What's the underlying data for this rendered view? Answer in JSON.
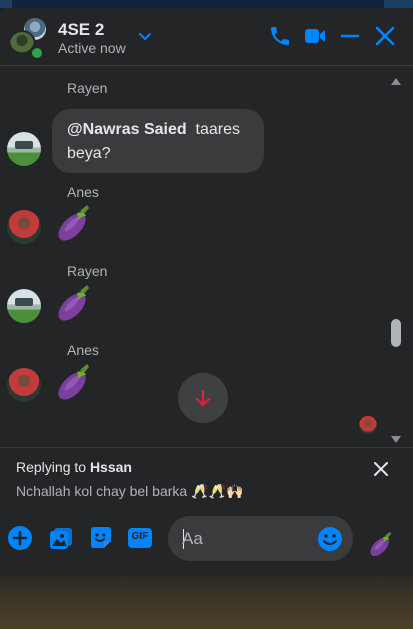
{
  "header": {
    "title": "4SE 2",
    "status": "Active now"
  },
  "messages": [
    {
      "sender": "Rayen",
      "mention": "@Nawras Saied",
      "text": "taares",
      "text2": "beya?",
      "type": "text"
    },
    {
      "sender": "Anes",
      "content": "eggplant-emoji",
      "type": "emoji"
    },
    {
      "sender": "Rayen",
      "content": "eggplant-emoji",
      "type": "emoji"
    },
    {
      "sender": "Anes",
      "content": "eggplant-emoji",
      "type": "emoji"
    }
  ],
  "reply": {
    "prefix": "Replying to",
    "name": "Hssan",
    "text": "Nchallah kol chay bel barka 🥂🥂🙌🏻"
  },
  "composer": {
    "placeholder": "Aa",
    "gif_label": "GIF"
  },
  "colors": {
    "accent": "#0084ff",
    "online": "#31a24c",
    "jump_arrow": "#e41e3f",
    "eggplant": "#7b3f9e"
  }
}
